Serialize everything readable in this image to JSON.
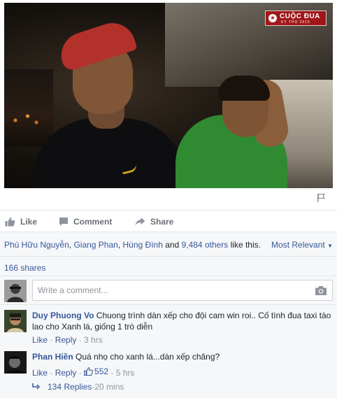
{
  "video": {
    "watermark_title": "CUỘC ĐUA",
    "watermark_subtitle": "KỲ THÚ 2015"
  },
  "actions": {
    "like": "Like",
    "comment": "Comment",
    "share": "Share"
  },
  "reactions": {
    "liker_1": "Phú Hữu Nguyễn",
    "sep_1": ", ",
    "liker_2": "Giang Phan",
    "sep_2": ", ",
    "liker_3": "Hùng Đình",
    "and_text": " and ",
    "others": "9,484 others",
    "suffix": " like this.",
    "sort": "Most Relevant"
  },
  "shares": "166 shares",
  "composer": {
    "placeholder": "Write a comment..."
  },
  "comments": [
    {
      "author": "Duy Phuong Vo",
      "text": "Chuong trình dàn xếp cho đội cam win roi.. Cố tình đua taxi tào lao cho Xanh lá, giống 1 trò diễn",
      "like": "Like",
      "reply": "Reply",
      "time": "3 hrs",
      "dot": " · "
    },
    {
      "author": "Phan Hiền",
      "text": "Quá nhọ cho xanh lá...dàn xếp chăng?",
      "like": "Like",
      "reply": "Reply",
      "likes": "552",
      "time": "5 hrs",
      "dot": " · "
    }
  ],
  "replies": {
    "label": "134 Replies",
    "time": "20 mins",
    "dot": " · "
  },
  "colors": {
    "link": "#365899",
    "meta": "#90949c",
    "panel_bg": "#f6f7f9",
    "action": "#6b6f76"
  }
}
